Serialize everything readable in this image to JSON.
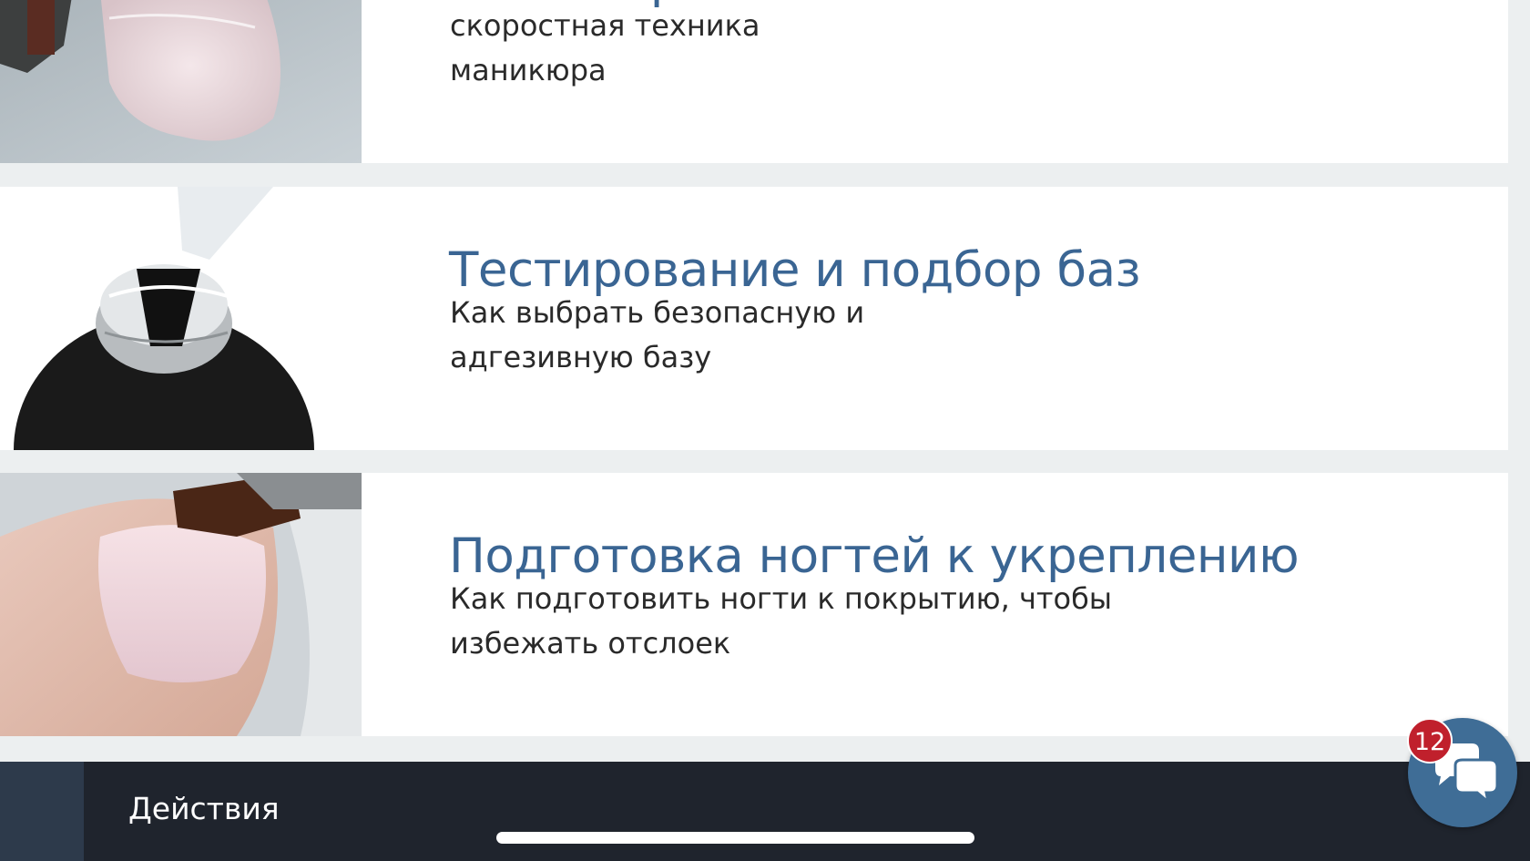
{
  "cards": [
    {
      "title": "Маникюр",
      "description": "скоростная техника маникюра",
      "image": "nail-manicure-photo"
    },
    {
      "title": "Тестирование и подбор баз",
      "description": "Как выбрать безопасную и адгезивную базу",
      "image": "base-coat-bottle-photo"
    },
    {
      "title": "Подготовка ногтей к укреплению",
      "description": "Как подготовить ногти к покрытию, чтобы избежать отслоек",
      "image": "nail-preparation-photo"
    }
  ],
  "actions_bar": {
    "label": "Действия"
  },
  "chat": {
    "badge_count": "12",
    "icon": "chat-bubbles-icon"
  },
  "colors": {
    "title": "#3a6593",
    "bar": "#1f242d",
    "chat_button": "#3f6d96",
    "badge": "#c0202c"
  }
}
